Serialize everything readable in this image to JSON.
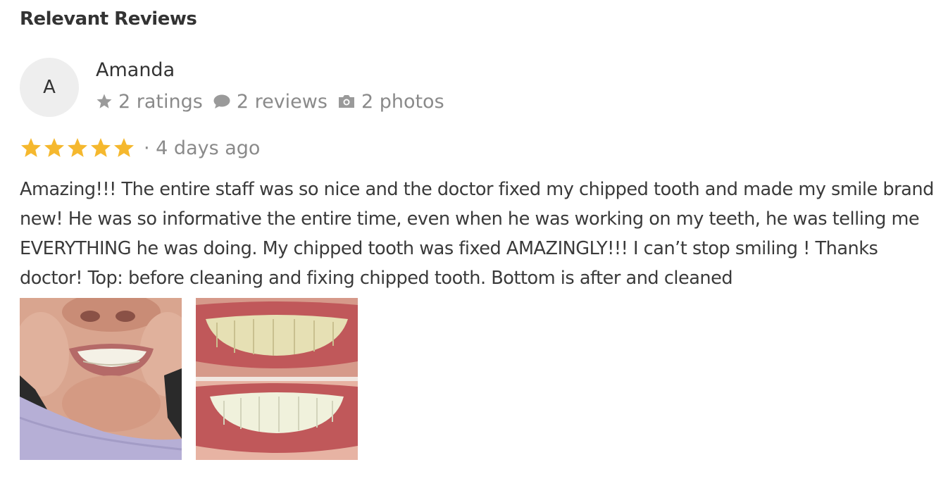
{
  "section": {
    "title": "Relevant Reviews"
  },
  "reviewer": {
    "initial": "A",
    "name": "Amanda",
    "ratings": "2 ratings",
    "reviews": "2 reviews",
    "photos": "2 photos"
  },
  "review": {
    "star_rating": 5,
    "star_color": "#f5b82e",
    "age": "· 4 days ago",
    "text": "Amazing!!! The entire staff was so nice and the doctor fixed my chipped tooth and made my smile brand new! He was so informative the entire time, even when he was working on my teeth, he was telling me EVERYTHING he was doing. My chipped tooth was fixed AMAZINGLY!!! I can’t stop smiling ! Thanks doctor! Top: before cleaning and fixing chipped tooth. Bottom is after and cleaned"
  },
  "icons": {
    "ratings": "star-icon",
    "reviews": "speech-bubble-icon",
    "photos": "camera-icon"
  },
  "colors": {
    "heading": "#333333",
    "meta_gray": "#8a8a8a",
    "avatar_bg": "#eeeeee"
  }
}
